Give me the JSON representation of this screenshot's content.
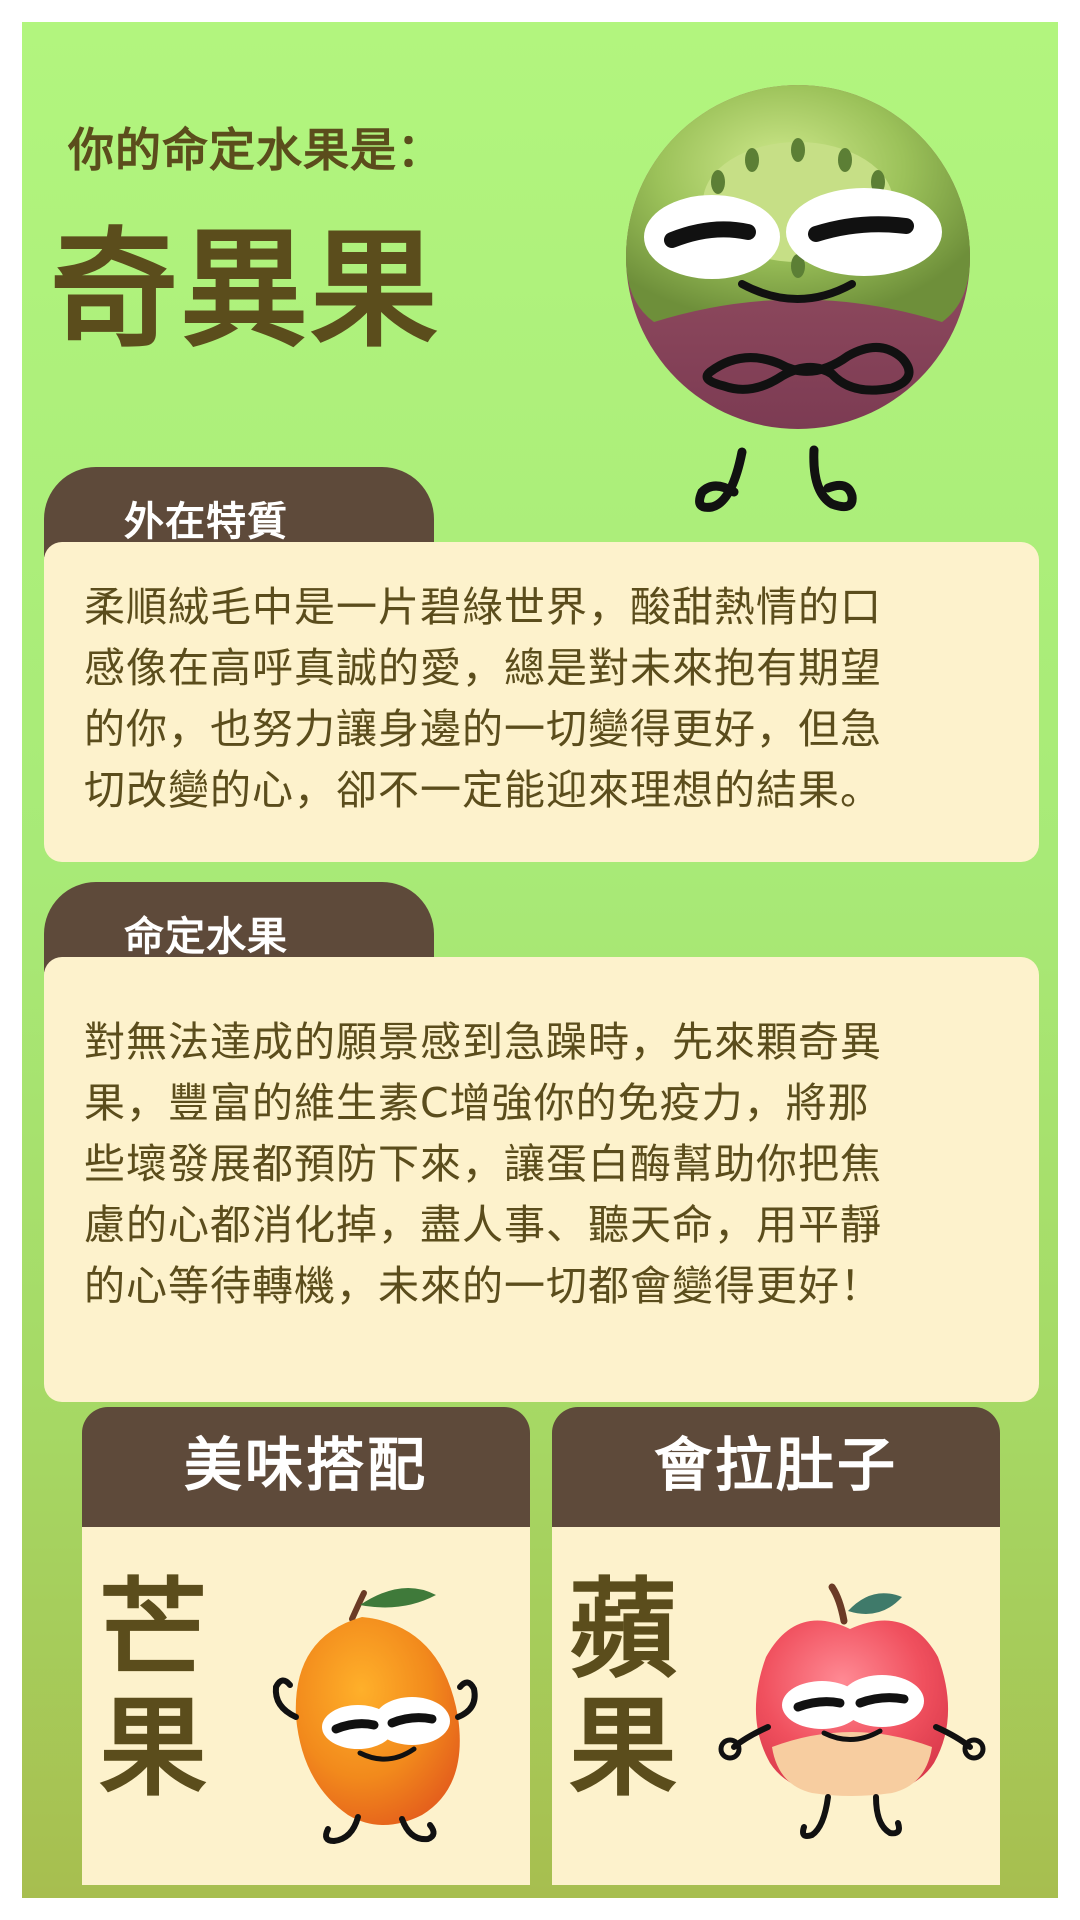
{
  "header": {
    "intro": "你的命定水果是：",
    "fruit_name": "奇異果"
  },
  "sections": [
    {
      "title": "外在特質",
      "lines": [
        "柔順絨毛中是一片碧綠世界，酸甜熱情的口",
        "感像在高呼真誠的愛，總是對未來抱有期望",
        "的你，也努力讓身邊的一切變得更好，但急",
        "切改變的心，卻不一定能迎來理想的結果。"
      ]
    },
    {
      "title": "命定水果",
      "lines": [
        "對無法達成的願景感到急躁時，先來顆奇異",
        "果，豐富的維生素C增強你的免疫力，將那",
        "些壞發展都預防下來，讓蛋白酶幫助你把焦",
        "慮的心都消化掉，盡人事、聽天命，用平靜",
        "的心等待轉機，未來的一切都會變得更好！"
      ]
    }
  ],
  "pairing": {
    "good": {
      "title": "美味搭配",
      "char1": "芒",
      "char2": "果",
      "icon": "mango-character-icon"
    },
    "bad": {
      "title": "會拉肚子",
      "char1": "蘋",
      "char2": "果",
      "icon": "apple-character-icon"
    }
  },
  "colors": {
    "background_top": "#b2f57e",
    "background_bottom": "#a7be4f",
    "text_dark": "#5b4d1c",
    "tab_brown": "#5e4a3a",
    "panel_cream": "#fdf2cc"
  }
}
